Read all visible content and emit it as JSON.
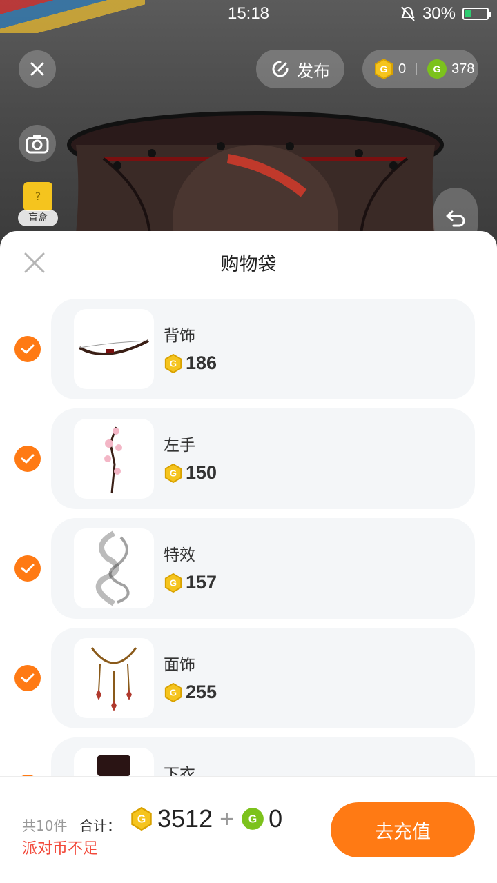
{
  "status_bar": {
    "time": "15:18",
    "battery": "30%",
    "battery_level": 0.3
  },
  "top_bar": {
    "publish_label": "发布",
    "wallet": {
      "gold_coins": "0",
      "green_coins": "378"
    },
    "blind_box_label": "盲盒",
    "blind_box_mark": "?"
  },
  "sheet": {
    "title": "购物袋",
    "items": [
      {
        "name": "背饰",
        "price": "186",
        "checked": true,
        "thumb": "bow"
      },
      {
        "name": "左手",
        "price": "150",
        "checked": true,
        "thumb": "plum-blossom-branch"
      },
      {
        "name": "特效",
        "price": "157",
        "checked": true,
        "thumb": "smoke"
      },
      {
        "name": "面饰",
        "price": "255",
        "checked": true,
        "thumb": "tassel-necklace"
      },
      {
        "name": "下衣",
        "price": "",
        "checked": true,
        "thumb": "skirt"
      }
    ]
  },
  "footer": {
    "count_text": "共10件",
    "total_label": "合计：",
    "gold_total": "3512",
    "plus": "+",
    "green_total": "0",
    "warning": "派对币不足",
    "recharge_label": "去充值"
  },
  "colors": {
    "accent": "#ff7a14",
    "warning": "#f24a3b",
    "gold": "#f5c41e",
    "green": "#7cc21c"
  }
}
